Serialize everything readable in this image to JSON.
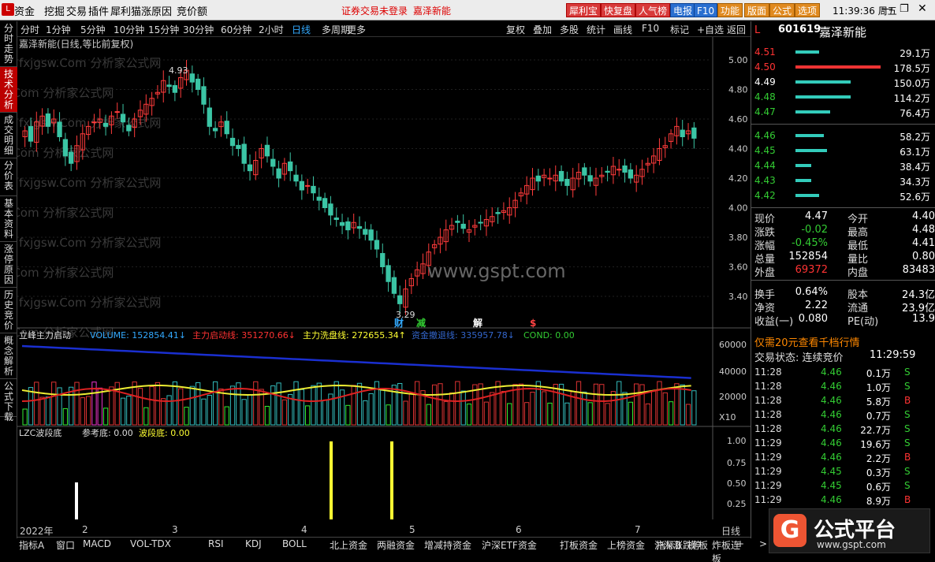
{
  "menubar": {
    "items": [
      "资金",
      "挖掘",
      "交易",
      "插件",
      "犀利猫",
      "涨原因",
      "竞价额"
    ],
    "notice": "证券交易未登录",
    "stock": "嘉泽新能",
    "buttons": [
      {
        "label": "犀利宝",
        "c": "r"
      },
      {
        "label": "快复盘",
        "c": "r"
      },
      {
        "label": "人气榜",
        "c": "r"
      },
      {
        "label": "电报",
        "c": "b"
      },
      {
        "label": "F10",
        "c": "b"
      },
      {
        "label": "功能",
        "c": "o"
      },
      {
        "label": "版面",
        "c": "o"
      },
      {
        "label": "公式",
        "c": "o"
      },
      {
        "label": "选项",
        "c": "o"
      }
    ],
    "clock": "11:39:36 周五"
  },
  "left_tabs": [
    "分时走势",
    "技术分析",
    "成交明细",
    "分价表",
    "基本资料",
    "涨停原因",
    "历史竞价",
    "概念解析",
    "公式下载"
  ],
  "period": {
    "items": [
      "分时",
      "1分钟",
      "5分钟",
      "10分钟",
      "15分钟",
      "30分钟",
      "60分钟",
      "2小时",
      "日线",
      "多周期",
      "更多"
    ],
    "active": "日线",
    "tools": [
      "复权",
      "叠加",
      "多股",
      "统计",
      "画线",
      "F10",
      "标记",
      "+自选",
      "返回"
    ]
  },
  "main": {
    "title": "嘉泽新能(日线,等比前复权)",
    "high_label": "4.93",
    "low_label": "3.29",
    "watermark": "www.gspt.com",
    "wmtext": "fxjgsw.Com 分析家公式网"
  },
  "price_axis": [
    "5.00",
    "4.80",
    "4.60",
    "4.40",
    "4.20",
    "4.00",
    "3.80",
    "3.60",
    "3.40"
  ],
  "vol_axis": [
    "60000",
    "40000",
    "20000",
    "X10"
  ],
  "lzc_axis": [
    "1.00",
    "0.75",
    "0.50",
    "0.25"
  ],
  "events": [
    "财",
    "减",
    "解",
    "$"
  ],
  "ind1": {
    "name": "立峰主力启动",
    "vol": "VOLUME: 152854.41↓",
    "a": "主力启动线: 351270.66↓",
    "b": "主力洗盘线: 272655.34↑",
    "c": "资金撤退线: 335957.78↓",
    "d": "COND: 0.00"
  },
  "ind2": {
    "name": "LZC波段底",
    "a": "参考底: 0.00",
    "b": "波段底: 0.00"
  },
  "time_axis": [
    "2022年",
    "2",
    "3",
    "4",
    "5",
    "6",
    "7"
  ],
  "time_right": "日线",
  "bottom": {
    "tabs": [
      "指标A",
      "窗口",
      "MACD",
      "VOL-TDX",
      "RSI",
      "KDJ",
      "BOLL",
      "北上资金",
      "两融资金",
      "增减持资金",
      "沪深ETF资金",
      "打板资金",
      "上榜资金",
      "沪深涨跌停",
      "炸板连板",
      ">"
    ],
    "right": [
      "指标B",
      "模",
      "板",
      "+"
    ]
  },
  "quote": {
    "code": "601619",
    "name": "嘉泽新能",
    "asks": [
      {
        "p": "4.51",
        "v": "29.1万"
      },
      {
        "p": "4.50",
        "v": "178.5万"
      },
      {
        "p": "4.49",
        "v": "150.0万"
      },
      {
        "p": "4.48",
        "v": "114.2万"
      },
      {
        "p": "4.47",
        "v": "76.4万"
      }
    ],
    "bids": [
      {
        "p": "4.46",
        "v": "58.2万"
      },
      {
        "p": "4.45",
        "v": "63.1万"
      },
      {
        "p": "4.44",
        "v": "38.4万"
      },
      {
        "p": "4.43",
        "v": "34.3万"
      },
      {
        "p": "4.42",
        "v": "52.6万"
      }
    ],
    "stats": [
      [
        "现价",
        "4.47",
        "今开",
        "4.40"
      ],
      [
        "涨跌",
        "-0.02",
        "最高",
        "4.48"
      ],
      [
        "涨幅",
        "-0.45%",
        "最低",
        "4.41"
      ],
      [
        "总量",
        "152854",
        "量比",
        "0.80"
      ],
      [
        "外盘",
        "69372",
        "内盘",
        "83483"
      ]
    ],
    "stats2": [
      [
        "换手",
        "0.64%",
        "股本",
        "24.3亿"
      ],
      [
        "净资",
        "2.22",
        "流通",
        "23.9亿"
      ],
      [
        "收益(一)",
        "0.080",
        "PE(动)",
        "13.9"
      ]
    ],
    "promo": "仅需20元查看千档行情",
    "status": "交易状态: 连续竞价",
    "status_time": "11:29:59",
    "ticks": [
      [
        "11:28",
        "4.46",
        "0.1万",
        "S"
      ],
      [
        "11:28",
        "4.46",
        "1.0万",
        "S"
      ],
      [
        "11:28",
        "4.46",
        "5.8万",
        "B"
      ],
      [
        "11:28",
        "4.46",
        "0.7万",
        "S"
      ],
      [
        "11:28",
        "4.46",
        "22.7万",
        "S"
      ],
      [
        "11:29",
        "4.46",
        "19.6万",
        "S"
      ],
      [
        "11:29",
        "4.46",
        "2.2万",
        "B"
      ],
      [
        "11:29",
        "4.45",
        "0.3万",
        "S"
      ],
      [
        "11:29",
        "4.45",
        "0.6万",
        "S"
      ],
      [
        "11:29",
        "4.46",
        "8.9万",
        "B"
      ]
    ]
  },
  "logo": {
    "text": "公式平台",
    "url": "www.gspt.com"
  },
  "chart_data": {
    "type": "candlestick",
    "closes": [
      4.52,
      4.45,
      4.58,
      4.62,
      4.55,
      4.6,
      4.48,
      4.35,
      4.3,
      4.42,
      4.5,
      4.55,
      4.58,
      4.6,
      4.55,
      4.62,
      4.65,
      4.58,
      4.52,
      4.6,
      4.66,
      4.7,
      4.74,
      4.78,
      4.86,
      4.82,
      4.78,
      4.88,
      4.93,
      4.85,
      4.8,
      4.7,
      4.55,
      4.52,
      4.58,
      4.5,
      4.42,
      4.4,
      4.3,
      4.25,
      4.32,
      4.4,
      4.35,
      4.28,
      4.2,
      4.3,
      4.25,
      4.18,
      4.12,
      4.15,
      4.1,
      4.05,
      4.0,
      3.95,
      3.92,
      3.88,
      3.85,
      3.9,
      3.86,
      3.82,
      3.78,
      3.72,
      3.6,
      3.5,
      3.42,
      3.35,
      3.45,
      3.52,
      3.58,
      3.62,
      3.7,
      3.75,
      3.8,
      3.85,
      3.88,
      3.9,
      3.86,
      3.85,
      3.88,
      3.9,
      3.92,
      3.94,
      3.96,
      3.98,
      4.0,
      4.05,
      4.1,
      4.15,
      4.2,
      4.18,
      4.22,
      4.2,
      4.22,
      4.18,
      4.15,
      4.2,
      4.24,
      4.22,
      4.18,
      4.2,
      4.22,
      4.24,
      4.28,
      4.26,
      4.24,
      4.2,
      4.22,
      4.26,
      4.3,
      4.35,
      4.4,
      4.42,
      4.5,
      4.55,
      4.48,
      4.52,
      4.47
    ],
    "ylim": [
      3.29,
      4.93
    ]
  }
}
